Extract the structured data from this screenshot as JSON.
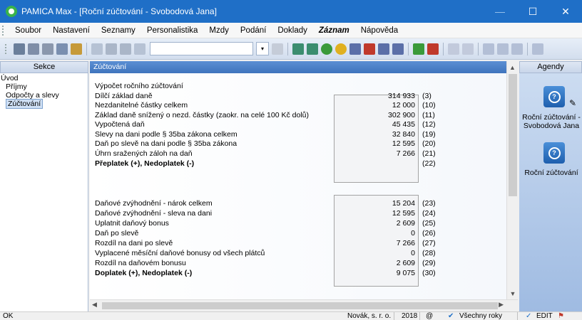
{
  "window": {
    "title": "PAMICA Max - [Roční zúčtování - Svobodová Jana]",
    "minimize": "—",
    "maximize": "☐",
    "close": "✕"
  },
  "menu": [
    "Soubor",
    "Nastavení",
    "Seznamy",
    "Personalistika",
    "Mzdy",
    "Podání",
    "Doklady",
    "Záznam",
    "Nápověda"
  ],
  "left_pane": {
    "header": "Sekce",
    "items": [
      "Úvod",
      "Příjmy",
      "Odpočty a slevy",
      "Zúčtování"
    ]
  },
  "main": {
    "header": "Zúčtování",
    "section1": [
      {
        "label": "Výpočet ročního zúčtování",
        "value": "",
        "code": ""
      },
      {
        "label": "Dílčí základ daně",
        "value": "314 933",
        "code": "(3)"
      },
      {
        "label": "Nezdanitelné částky celkem",
        "value": "12 000",
        "code": "(10)"
      },
      {
        "label": "Základ daně snížený o nezd. částky (zaokr. na celé 100 Kč dolů)",
        "value": "302 900",
        "code": "(11)"
      },
      {
        "label": "Vypočtená daň",
        "value": "45 435",
        "code": "(12)"
      },
      {
        "label": "Slevy na dani podle § 35ba zákona celkem",
        "value": "32 840",
        "code": "(19)"
      },
      {
        "label": "Daň po slevě na dani podle § 35ba zákona",
        "value": "12 595",
        "code": "(20)"
      },
      {
        "label": "Úhrn sražených záloh na daň",
        "value": "7 266",
        "code": "(21)"
      },
      {
        "label": "Přeplatek (+), Nedoplatek (-)",
        "value": "",
        "code": "(22)"
      }
    ],
    "section2": [
      {
        "label": "Daňové zvýhodnění - nárok celkem",
        "value": "15 204",
        "code": "(23)"
      },
      {
        "label": "Daňové zvýhodnění - sleva na dani",
        "value": "12 595",
        "code": "(24)"
      },
      {
        "label": "Uplatnit daňový bonus",
        "value": "2 609",
        "code": "(25)"
      },
      {
        "label": "Daň po slevě",
        "value": "0",
        "code": "(26)"
      },
      {
        "label": "Rozdíl na dani po slevě",
        "value": "7 266",
        "code": "(27)"
      },
      {
        "label": "Vyplacené měsíční daňové bonusy od všech plátců",
        "value": "0",
        "code": "(28)"
      },
      {
        "label": "Rozdíl na daňovém bonusu",
        "value": "2 609",
        "code": "(29)"
      },
      {
        "label": "Doplatek (+), Nedoplatek (-)",
        "value": "9 075",
        "code": "(30)"
      }
    ]
  },
  "right_pane": {
    "header": "Agendy",
    "items": [
      "Roční zúčtování - Svobodová Jana",
      "Roční zúčtování"
    ]
  },
  "status": {
    "left": "OK",
    "company": "Novák, s. r. o.",
    "year": "2018",
    "at": "@",
    "years": "Všechny roky",
    "edit": "EDIT"
  },
  "colors": {
    "titlebar": "#1f6fc7",
    "header_blue": "#3f74bd",
    "agendy_bg": "#9fbbe2"
  }
}
